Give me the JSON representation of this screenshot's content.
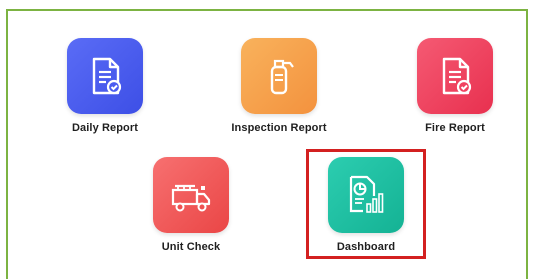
{
  "colors": {
    "frame_border": "#7cb342",
    "highlight_border": "#d32020",
    "daily_report": "#4a5cf0",
    "inspection_report": "#f7a24c",
    "fire_report": "#f0415f",
    "unit_check": "#f05a5a",
    "dashboard": "#1fc0a3"
  },
  "apps": {
    "daily_report": {
      "label": "Daily Report",
      "icon": "document-check-icon"
    },
    "inspection_report": {
      "label": "Inspection Report",
      "icon": "fire-extinguisher-icon"
    },
    "fire_report": {
      "label": "Fire Report",
      "icon": "document-check-icon"
    },
    "unit_check": {
      "label": "Unit Check",
      "icon": "fire-truck-icon"
    },
    "dashboard": {
      "label": "Dashboard",
      "icon": "chart-report-icon",
      "selected": true
    }
  }
}
